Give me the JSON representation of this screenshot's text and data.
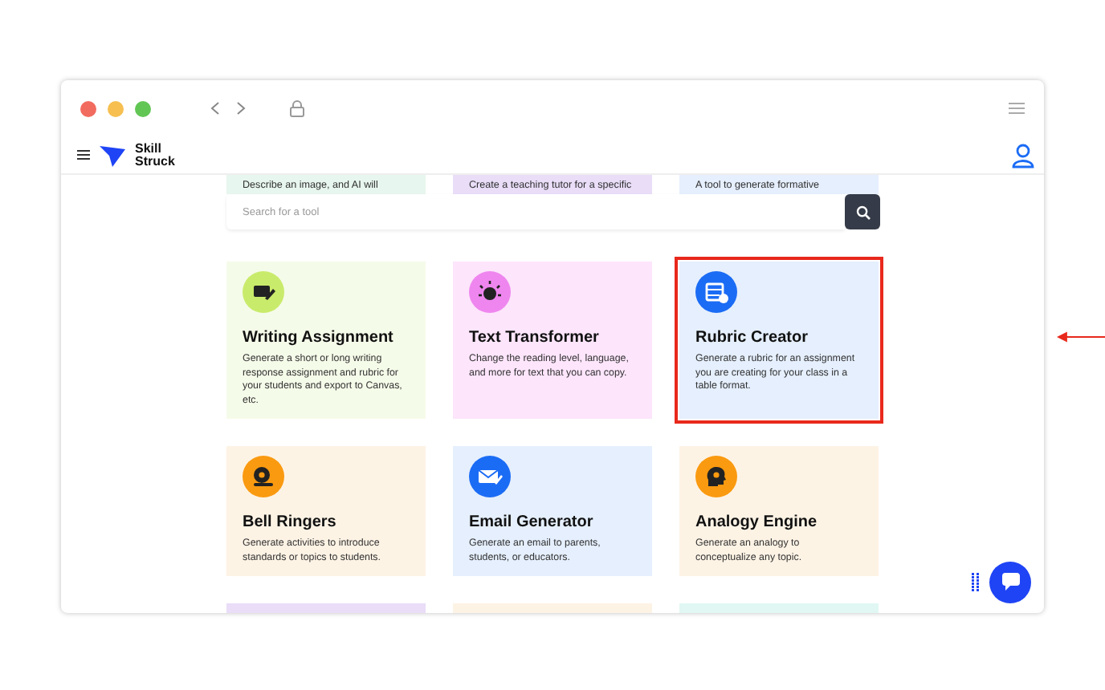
{
  "browser": {
    "traffic_lights": [
      {
        "color": "#f26b5f"
      },
      {
        "color": "#f6bf50"
      },
      {
        "color": "#62c655"
      }
    ]
  },
  "header": {
    "brand": "Skill Struck"
  },
  "search": {
    "placeholder": "Search for a tool"
  },
  "partial_top": [
    {
      "description": "Describe an image, and AI will",
      "color": "#e7f6ee"
    },
    {
      "description": "Create a teaching tutor for a specific",
      "color": "#e9ddf8"
    },
    {
      "description": "A tool to generate formative",
      "color": "#e6effd"
    }
  ],
  "cards": [
    {
      "kind": "pencil",
      "title": "Writing Assignment",
      "description": "Generate a short or long writing response assignment and rubric for your students and export to Canvas, etc.",
      "color": "#f5fbe9",
      "highlighted": false
    },
    {
      "kind": "sun",
      "title": "Text Transformer",
      "description": "Change the reading level, language, and more for text that you can copy.",
      "color": "#fde5fb",
      "highlighted": false
    },
    {
      "kind": "table",
      "title": "Rubric Creator",
      "description": "Generate a rubric for an assignment you are creating for your class in a table format.",
      "color": "#e5effd",
      "highlighted": true
    },
    {
      "kind": "bell",
      "title": "Bell Ringers",
      "description": "Generate activities to introduce standards or topics to students.",
      "color": "#fdf3e5",
      "highlighted": false
    },
    {
      "kind": "mail",
      "title": "Email Generator",
      "description": "Generate an email to parents, students, or educators.",
      "color": "#e5effd",
      "highlighted": false
    },
    {
      "kind": "head",
      "title": "Analogy Engine",
      "description": "Generate an analogy to conceptualize any topic.",
      "color": "#fdf3e5",
      "highlighted": false
    }
  ],
  "partial_bottom": [
    {
      "color": "#e9ddf8"
    },
    {
      "color": "#fdf3e5"
    },
    {
      "color": "#e0f7f3"
    }
  ]
}
